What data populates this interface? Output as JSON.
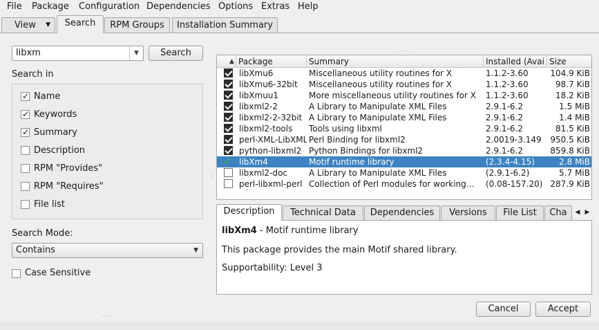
{
  "menu": [
    {
      "label": "File",
      "mnemonic": "F",
      "rest": "ile"
    },
    {
      "label": "Package",
      "mnemonic": "P",
      "rest": "ackage"
    },
    {
      "label": "Configuration",
      "mnemonic": "C",
      "rest": "onfiguration"
    },
    {
      "label": "Dependencies",
      "mnemonic": "D",
      "rest": "ependencies"
    },
    {
      "label": "Options",
      "mnemonic": "O",
      "rest": "ptions"
    },
    {
      "label": "Extras",
      "mnemonic": "E",
      "rest": "xtras"
    },
    {
      "label": "Help",
      "mnemonic": "H",
      "rest": "elp"
    }
  ],
  "top_tabs": {
    "view": "View",
    "search": "Search",
    "rpm_groups": "RPM Groups",
    "installation_summary": "Installation Summary"
  },
  "search": {
    "query": "libxm",
    "button": "Search",
    "search_in_label": "Search in",
    "options": [
      {
        "label": "Name",
        "checked": true
      },
      {
        "label": "Keywords",
        "checked": true
      },
      {
        "label": "Summary",
        "checked": true
      },
      {
        "label": "Description",
        "checked": false
      },
      {
        "label": "RPM \"Provides\"",
        "checked": false
      },
      {
        "label": "RPM \"Requires\"",
        "checked": false
      },
      {
        "label": "File list",
        "checked": false
      }
    ],
    "mode_label": "Search Mode:",
    "mode_value": "Contains",
    "case_sensitive": "Case Sensitive"
  },
  "table": {
    "columns": [
      "Package",
      "Summary",
      "Installed (Avai",
      "Size"
    ],
    "rows": [
      {
        "status": "installed",
        "package": "libXmu6",
        "summary": "Miscellaneous utility routines for X",
        "installed": "1.1.2-3.60",
        "size": "104.9 KiB"
      },
      {
        "status": "installed",
        "package": "libXmu6-32bit",
        "summary": "Miscellaneous utility routines for X",
        "installed": "1.1.2-3.60",
        "size": "98.7 KiB"
      },
      {
        "status": "installed",
        "package": "libXmuu1",
        "summary": "More miscellaneous utility routines for X",
        "installed": "1.1.2-3.60",
        "size": "18.2 KiB"
      },
      {
        "status": "installed",
        "package": "libxml2-2",
        "summary": "A Library to Manipulate XML Files",
        "installed": "2.9.1-6.2",
        "size": "1.5 MiB"
      },
      {
        "status": "installed",
        "package": "libxml2-2-32bit",
        "summary": "A Library to Manipulate XML Files",
        "installed": "2.9.1-6.2",
        "size": "1.4 MiB"
      },
      {
        "status": "installed",
        "package": "libxml2-tools",
        "summary": "Tools using libxml",
        "installed": "2.9.1-6.2",
        "size": "81.5 KiB"
      },
      {
        "status": "installed",
        "package": "perl-XML-LibXML",
        "summary": "Perl Binding for libxml2",
        "installed": "2.0019-3.149",
        "size": "950.5 KiB"
      },
      {
        "status": "installed",
        "package": "python-libxml2",
        "summary": "Python Bindings for libxml2",
        "installed": "2.9.1-6.2",
        "size": "859.8 KiB"
      },
      {
        "status": "to-install",
        "package": "libXm4",
        "summary": "Motif runtime library",
        "installed": "(2.3.4-4.15)",
        "size": "2.8 MiB",
        "selected": true
      },
      {
        "status": "available",
        "package": "libxml2-doc",
        "summary": "A Library to Manipulate XML Files",
        "installed": "(2.9.1-6.2)",
        "size": "5.7 MiB"
      },
      {
        "status": "available",
        "package": "perl-libxml-perl",
        "summary": "Collection of Perl modules for working…",
        "installed": "(0.08-157.20)",
        "size": "287.9 KiB"
      }
    ]
  },
  "detail_tabs": [
    "Description",
    "Technical Data",
    "Dependencies",
    "Versions",
    "File List",
    "Cha"
  ],
  "details": {
    "name": "libXm4",
    "summary_sep": " - Motif runtime library",
    "description": "This package provides the main Motif shared library.",
    "supportability": "Supportability: Level 3"
  },
  "buttons": {
    "cancel": "Cancel",
    "accept": "Accept"
  },
  "icons": {
    "sort": "sort-ascending-icon",
    "dropdown": "chevron-down-icon",
    "scroll_right": "chevron-right-icon"
  }
}
